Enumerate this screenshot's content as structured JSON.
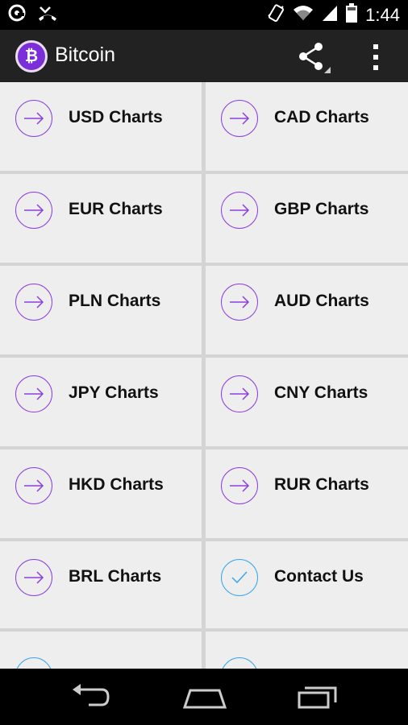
{
  "status_bar": {
    "time": "1:44",
    "icons": [
      "notification-icon",
      "missed-call-icon",
      "vibrate-icon",
      "wifi-icon",
      "signal-icon",
      "battery-icon"
    ]
  },
  "action_bar": {
    "title": "Bitcoin",
    "logo_letter": "₿",
    "icons": [
      "share-icon",
      "overflow-menu-icon"
    ]
  },
  "tiles": [
    {
      "label": "USD Charts",
      "icon": "arrow-right-icon",
      "color": "#8d3fe0"
    },
    {
      "label": "CAD Charts",
      "icon": "arrow-right-icon",
      "color": "#8d3fe0"
    },
    {
      "label": "EUR Charts",
      "icon": "arrow-right-icon",
      "color": "#8d3fe0"
    },
    {
      "label": "GBP Charts",
      "icon": "arrow-right-icon",
      "color": "#8d3fe0"
    },
    {
      "label": "PLN Charts",
      "icon": "arrow-right-icon",
      "color": "#8d3fe0"
    },
    {
      "label": "AUD Charts",
      "icon": "arrow-right-icon",
      "color": "#8d3fe0"
    },
    {
      "label": "JPY Charts",
      "icon": "arrow-right-icon",
      "color": "#8d3fe0"
    },
    {
      "label": "CNY Charts",
      "icon": "arrow-right-icon",
      "color": "#8d3fe0"
    },
    {
      "label": "HKD Charts",
      "icon": "arrow-right-icon",
      "color": "#8d3fe0"
    },
    {
      "label": "RUR Charts",
      "icon": "arrow-right-icon",
      "color": "#8d3fe0"
    },
    {
      "label": "BRL Charts",
      "icon": "arrow-right-icon",
      "color": "#8d3fe0"
    },
    {
      "label": "Contact Us",
      "icon": "checkmark-icon",
      "color": "#3aa7e8"
    }
  ],
  "partial_tiles": [
    {
      "icon": "partial-circle-icon",
      "color": "#3aa7e8"
    },
    {
      "icon": "partial-circle-icon",
      "color": "#3aa7e8"
    }
  ],
  "nav_bar": {
    "icons": [
      "back-icon",
      "home-icon",
      "recent-apps-icon"
    ]
  }
}
